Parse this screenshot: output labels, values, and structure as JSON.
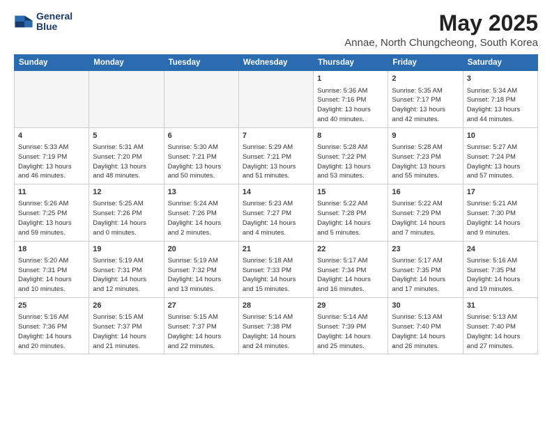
{
  "logo": {
    "line1": "General",
    "line2": "Blue"
  },
  "title": "May 2025",
  "subtitle": "Annae, North Chungcheong, South Korea",
  "days_of_week": [
    "Sunday",
    "Monday",
    "Tuesday",
    "Wednesday",
    "Thursday",
    "Friday",
    "Saturday"
  ],
  "weeks": [
    [
      {
        "day": "",
        "empty": true
      },
      {
        "day": "",
        "empty": true
      },
      {
        "day": "",
        "empty": true
      },
      {
        "day": "",
        "empty": true
      },
      {
        "day": "1",
        "info": "Sunrise: 5:36 AM\nSunset: 7:16 PM\nDaylight: 13 hours\nand 40 minutes."
      },
      {
        "day": "2",
        "info": "Sunrise: 5:35 AM\nSunset: 7:17 PM\nDaylight: 13 hours\nand 42 minutes."
      },
      {
        "day": "3",
        "info": "Sunrise: 5:34 AM\nSunset: 7:18 PM\nDaylight: 13 hours\nand 44 minutes."
      }
    ],
    [
      {
        "day": "4",
        "info": "Sunrise: 5:33 AM\nSunset: 7:19 PM\nDaylight: 13 hours\nand 46 minutes."
      },
      {
        "day": "5",
        "info": "Sunrise: 5:31 AM\nSunset: 7:20 PM\nDaylight: 13 hours\nand 48 minutes."
      },
      {
        "day": "6",
        "info": "Sunrise: 5:30 AM\nSunset: 7:21 PM\nDaylight: 13 hours\nand 50 minutes."
      },
      {
        "day": "7",
        "info": "Sunrise: 5:29 AM\nSunset: 7:21 PM\nDaylight: 13 hours\nand 51 minutes."
      },
      {
        "day": "8",
        "info": "Sunrise: 5:28 AM\nSunset: 7:22 PM\nDaylight: 13 hours\nand 53 minutes."
      },
      {
        "day": "9",
        "info": "Sunrise: 5:28 AM\nSunset: 7:23 PM\nDaylight: 13 hours\nand 55 minutes."
      },
      {
        "day": "10",
        "info": "Sunrise: 5:27 AM\nSunset: 7:24 PM\nDaylight: 13 hours\nand 57 minutes."
      }
    ],
    [
      {
        "day": "11",
        "info": "Sunrise: 5:26 AM\nSunset: 7:25 PM\nDaylight: 13 hours\nand 59 minutes."
      },
      {
        "day": "12",
        "info": "Sunrise: 5:25 AM\nSunset: 7:26 PM\nDaylight: 14 hours\nand 0 minutes."
      },
      {
        "day": "13",
        "info": "Sunrise: 5:24 AM\nSunset: 7:26 PM\nDaylight: 14 hours\nand 2 minutes."
      },
      {
        "day": "14",
        "info": "Sunrise: 5:23 AM\nSunset: 7:27 PM\nDaylight: 14 hours\nand 4 minutes."
      },
      {
        "day": "15",
        "info": "Sunrise: 5:22 AM\nSunset: 7:28 PM\nDaylight: 14 hours\nand 5 minutes."
      },
      {
        "day": "16",
        "info": "Sunrise: 5:22 AM\nSunset: 7:29 PM\nDaylight: 14 hours\nand 7 minutes."
      },
      {
        "day": "17",
        "info": "Sunrise: 5:21 AM\nSunset: 7:30 PM\nDaylight: 14 hours\nand 9 minutes."
      }
    ],
    [
      {
        "day": "18",
        "info": "Sunrise: 5:20 AM\nSunset: 7:31 PM\nDaylight: 14 hours\nand 10 minutes."
      },
      {
        "day": "19",
        "info": "Sunrise: 5:19 AM\nSunset: 7:31 PM\nDaylight: 14 hours\nand 12 minutes."
      },
      {
        "day": "20",
        "info": "Sunrise: 5:19 AM\nSunset: 7:32 PM\nDaylight: 14 hours\nand 13 minutes."
      },
      {
        "day": "21",
        "info": "Sunrise: 5:18 AM\nSunset: 7:33 PM\nDaylight: 14 hours\nand 15 minutes."
      },
      {
        "day": "22",
        "info": "Sunrise: 5:17 AM\nSunset: 7:34 PM\nDaylight: 14 hours\nand 16 minutes."
      },
      {
        "day": "23",
        "info": "Sunrise: 5:17 AM\nSunset: 7:35 PM\nDaylight: 14 hours\nand 17 minutes."
      },
      {
        "day": "24",
        "info": "Sunrise: 5:16 AM\nSunset: 7:35 PM\nDaylight: 14 hours\nand 19 minutes."
      }
    ],
    [
      {
        "day": "25",
        "info": "Sunrise: 5:16 AM\nSunset: 7:36 PM\nDaylight: 14 hours\nand 20 minutes."
      },
      {
        "day": "26",
        "info": "Sunrise: 5:15 AM\nSunset: 7:37 PM\nDaylight: 14 hours\nand 21 minutes."
      },
      {
        "day": "27",
        "info": "Sunrise: 5:15 AM\nSunset: 7:37 PM\nDaylight: 14 hours\nand 22 minutes."
      },
      {
        "day": "28",
        "info": "Sunrise: 5:14 AM\nSunset: 7:38 PM\nDaylight: 14 hours\nand 24 minutes."
      },
      {
        "day": "29",
        "info": "Sunrise: 5:14 AM\nSunset: 7:39 PM\nDaylight: 14 hours\nand 25 minutes."
      },
      {
        "day": "30",
        "info": "Sunrise: 5:13 AM\nSunset: 7:40 PM\nDaylight: 14 hours\nand 26 minutes."
      },
      {
        "day": "31",
        "info": "Sunrise: 5:13 AM\nSunset: 7:40 PM\nDaylight: 14 hours\nand 27 minutes."
      }
    ]
  ]
}
